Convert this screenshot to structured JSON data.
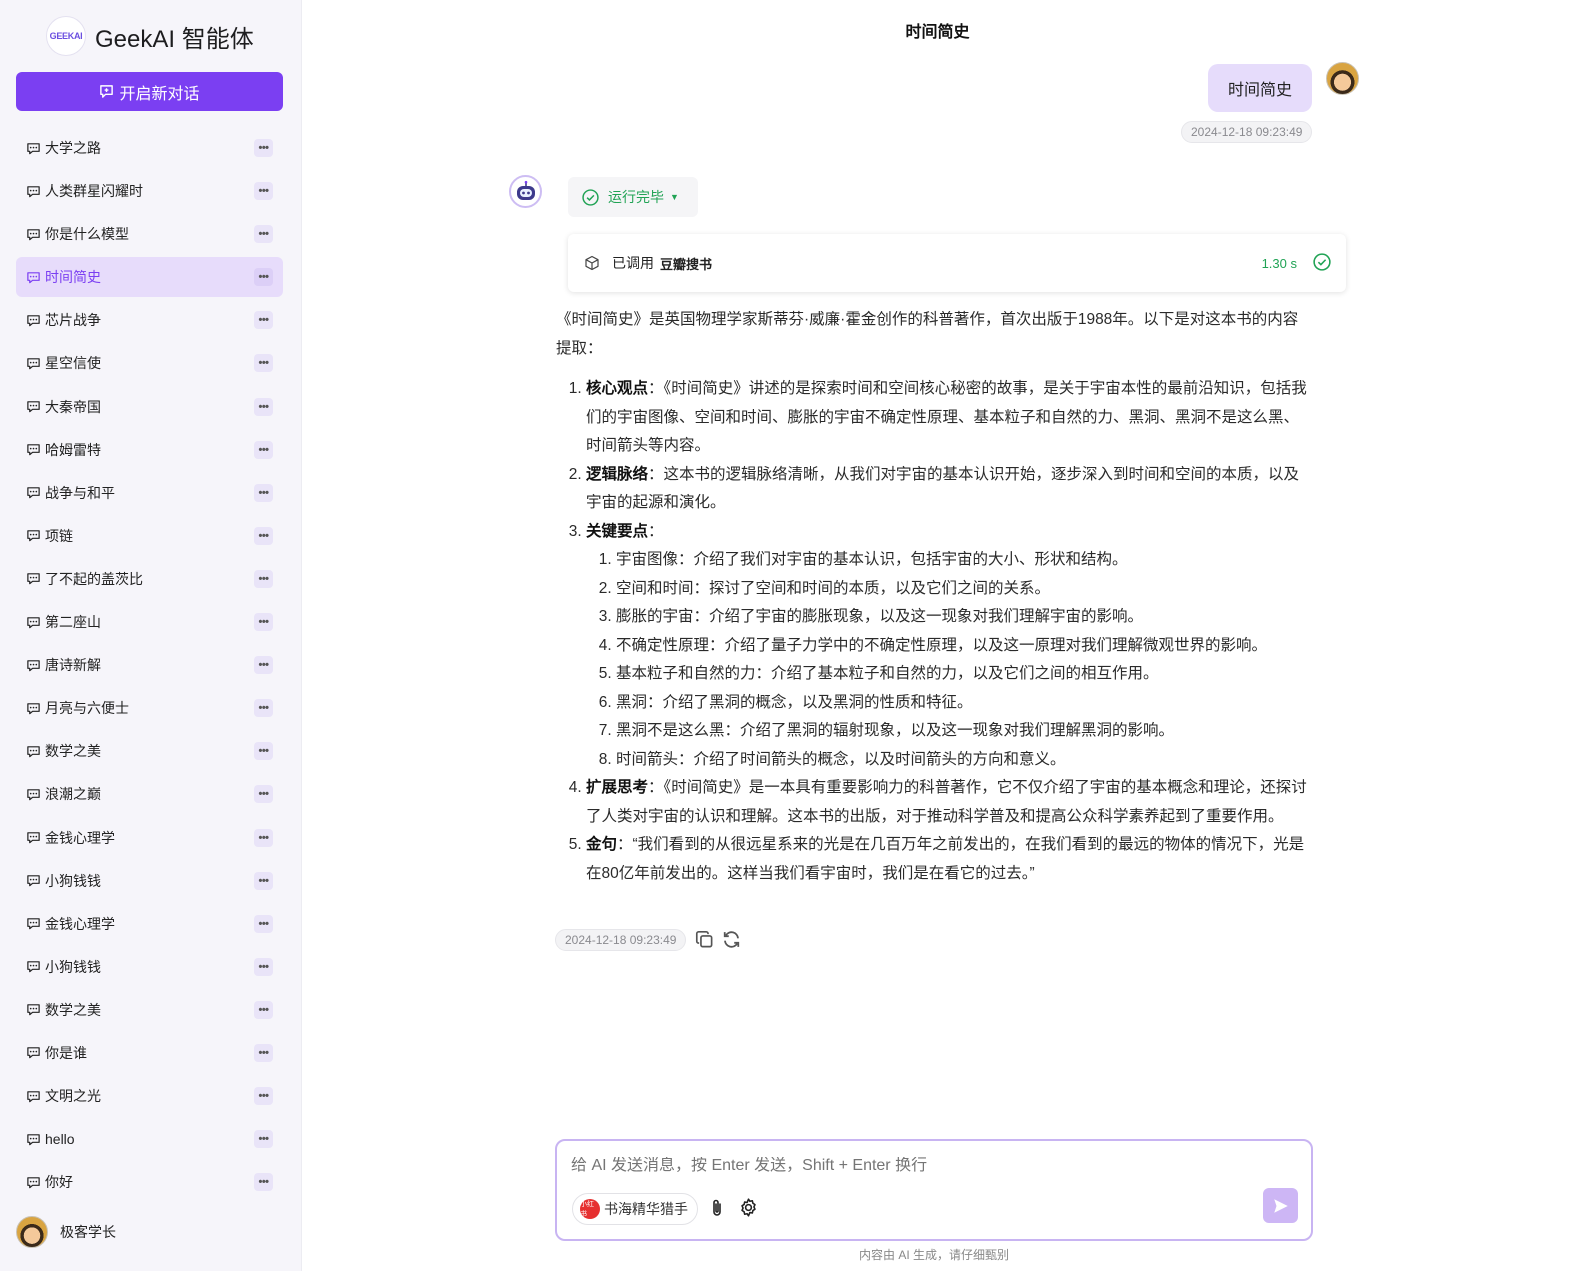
{
  "brand": {
    "logo_text": "GEEKAI",
    "name": "GeekAI 智能体"
  },
  "sidebar": {
    "new_chat_label": "开启新对话",
    "more_glyph": "•••",
    "items": [
      {
        "label": "大学之路"
      },
      {
        "label": "人类群星闪耀时"
      },
      {
        "label": "你是什么模型"
      },
      {
        "label": "时间简史",
        "active": true
      },
      {
        "label": "芯片战争"
      },
      {
        "label": "星空信使"
      },
      {
        "label": "大秦帝国"
      },
      {
        "label": "哈姆雷特"
      },
      {
        "label": "战争与和平"
      },
      {
        "label": "项链"
      },
      {
        "label": "了不起的盖茨比"
      },
      {
        "label": "第二座山"
      },
      {
        "label": "唐诗新解"
      },
      {
        "label": "月亮与六便士"
      },
      {
        "label": "数学之美"
      },
      {
        "label": "浪潮之巅"
      },
      {
        "label": "金钱心理学"
      },
      {
        "label": "小狗钱钱"
      },
      {
        "label": "金钱心理学"
      },
      {
        "label": "小狗钱钱"
      },
      {
        "label": "数学之美"
      },
      {
        "label": "你是谁"
      },
      {
        "label": "文明之光"
      },
      {
        "label": "hello"
      },
      {
        "label": "你好"
      }
    ],
    "user_name": "极客学长"
  },
  "chat": {
    "title": "时间简史",
    "user_message": "时间简史",
    "user_time": "2024-12-18 09:23:49",
    "run_status": "运行完毕",
    "tool": {
      "prefix": "已调用",
      "name": "豆瓣搜书",
      "duration": "1.30 s"
    },
    "answer": {
      "intro": "《时间简史》是英国物理学家斯蒂芬·威廉·霍金创作的科普著作，首次出版于1988年。以下是对这本书的内容提取：",
      "points": [
        {
          "title": "核心观点",
          "text": "：《时间简史》讲述的是探索时间和空间核心秘密的故事，是关于宇宙本性的最前沿知识，包括我们的宇宙图像、空间和时间、膨胀的宇宙不确定性原理、基本粒子和自然的力、黑洞、黑洞不是这么黑、时间箭头等内容。"
        },
        {
          "title": "逻辑脉络",
          "text": "：这本书的逻辑脉络清晰，从我们对宇宙的基本认识开始，逐步深入到时间和空间的本质，以及宇宙的起源和演化。"
        },
        {
          "title": "关键要点",
          "text": "："
        },
        {
          "title": "扩展思考",
          "text": "：《时间简史》是一本具有重要影响力的科普著作，它不仅介绍了宇宙的基本概念和理论，还探讨了人类对宇宙的认识和理解。这本书的出版，对于推动科学普及和提高公众科学素养起到了重要作用。"
        },
        {
          "title": "金句",
          "text": "：“我们看到的从很远星系来的光是在几百万年之前发出的，在我们看到的最远的物体的情况下，光是在80亿年前发出的。这样当我们看宇宙时，我们是在看它的过去。”"
        }
      ],
      "key_points": [
        "宇宙图像：介绍了我们对宇宙的基本认识，包括宇宙的大小、形状和结构。",
        "空间和时间：探讨了空间和时间的本质，以及它们之间的关系。",
        "膨胀的宇宙：介绍了宇宙的膨胀现象，以及这一现象对我们理解宇宙的影响。",
        "不确定性原理：介绍了量子力学中的不确定性原理，以及这一原理对我们理解微观世界的影响。",
        "基本粒子和自然的力：介绍了基本粒子和自然的力，以及它们之间的相互作用。",
        "黑洞：介绍了黑洞的概念，以及黑洞的性质和特征。",
        "黑洞不是这么黑：介绍了黑洞的辐射现象，以及这一现象对我们理解黑洞的影响。",
        "时间箭头：介绍了时间箭头的概念，以及时间箭头的方向和意义。"
      ]
    },
    "bot_time": "2024-12-18 09:23:49"
  },
  "input": {
    "placeholder": "给 AI 发送消息，按 Enter 发送，Shift + Enter 换行",
    "agent_badge": "小红书",
    "agent_name": "书海精华猎手"
  },
  "disclaimer": "内容由 AI 生成，请仔细甄别",
  "colors": {
    "accent": "#7b3ff2",
    "success": "#21a355",
    "bubble": "#e6dcfb"
  }
}
